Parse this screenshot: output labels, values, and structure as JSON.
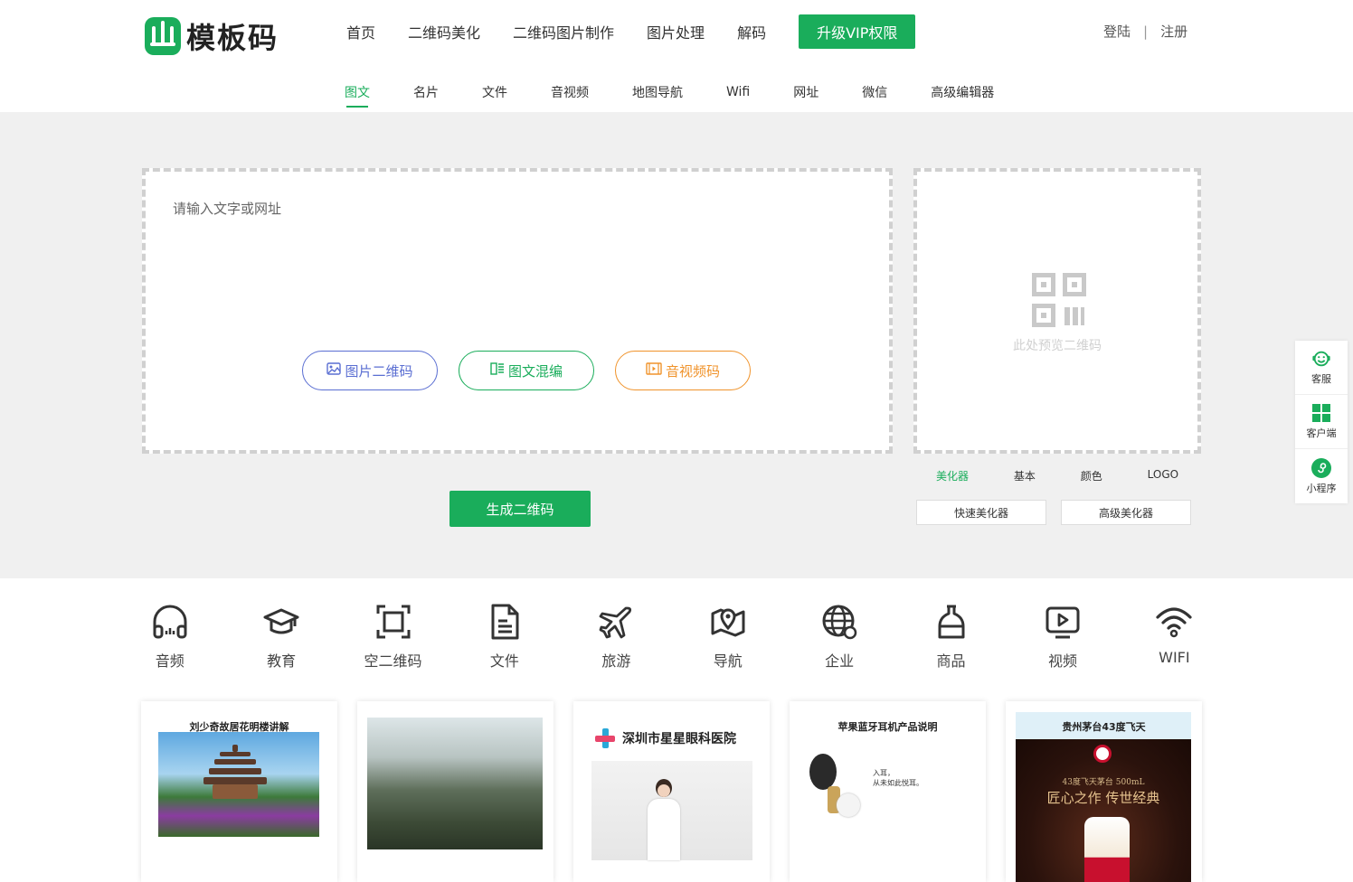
{
  "header": {
    "logo_text": "模板码",
    "nav": [
      "首页",
      "二维码美化",
      "二维码图片制作",
      "图片处理",
      "解码"
    ],
    "vip_label": "升级VIP权限",
    "login": "登陆",
    "separator": "|",
    "register": "注册"
  },
  "subnav": {
    "tabs": [
      "图文",
      "名片",
      "文件",
      "音视频",
      "地图导航",
      "Wifi",
      "网址",
      "微信",
      "高级编辑器"
    ],
    "active": "图文"
  },
  "editor": {
    "placeholder": "请输入文字或网址",
    "btn_image": "图片二维码",
    "btn_mix": "图文混编",
    "btn_av": "音视频码",
    "generate": "生成二维码"
  },
  "preview": {
    "placeholder": "此处预览二维码",
    "tabs": [
      "美化器",
      "基本",
      "颜色",
      "LOGO"
    ],
    "active_tab": "美化器",
    "quick": "快速美化器",
    "advanced": "高级美化器"
  },
  "side": {
    "service": "客服",
    "client": "客户端",
    "miniapp": "小程序"
  },
  "categories": [
    {
      "label": "音频",
      "icon": "headphones-icon"
    },
    {
      "label": "教育",
      "icon": "graduation-cap-icon"
    },
    {
      "label": "空二维码",
      "icon": "scan-frame-icon"
    },
    {
      "label": "文件",
      "icon": "document-icon"
    },
    {
      "label": "旅游",
      "icon": "airplane-icon"
    },
    {
      "label": "导航",
      "icon": "map-pin-icon"
    },
    {
      "label": "企业",
      "icon": "globe-icon"
    },
    {
      "label": "商品",
      "icon": "product-bottle-icon"
    },
    {
      "label": "视频",
      "icon": "video-play-icon"
    },
    {
      "label": "WIFI",
      "icon": "wifi-icon"
    }
  ],
  "cards": {
    "c1_title": "刘少奇故居花明楼讲解",
    "c3_title": "深圳市星星眼科医院",
    "c4_title": "苹果蓝牙耳机产品说明",
    "c4_line1": "入耳，",
    "c4_line2": "从未如此悦耳。",
    "c5_title": "贵州茅台43度飞天",
    "c5_sub": "43度飞天茅台 500mL",
    "c5_slogan": "匠心之作 传世经典"
  },
  "colors": {
    "accent": "#1aad5b",
    "blue": "#5a6ed2",
    "orange": "#f0932b",
    "work_bg": "#f0f0f0"
  }
}
